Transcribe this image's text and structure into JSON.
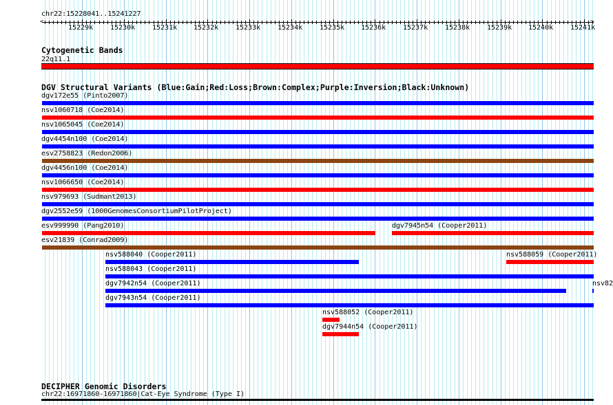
{
  "ruler": {
    "range_label": "chr22:15228041..15241227",
    "tick_labels": [
      "15229k",
      "15230k",
      "15231k",
      "15232k",
      "15233k",
      "15234k",
      "15235k",
      "15236k",
      "15237k",
      "15238k",
      "15239k",
      "15240k",
      "15241k"
    ]
  },
  "cytoband": {
    "title": "Cytogenetic Bands",
    "label": "22q11.1",
    "color": "#ff0000"
  },
  "dgv": {
    "title": "DGV Structural Variants (Blue:Gain;Red:Loss;Brown:Complex;Purple:Inversion;Black:Unknown)",
    "colors": {
      "gain": "#0000ff",
      "loss": "#ff0000",
      "complex": "#8b4513"
    },
    "features": [
      {
        "label": "dgv172e55 (Pinto2007)",
        "type": "gain"
      },
      {
        "label": "nsv1060718 (Coe2014)",
        "type": "loss"
      },
      {
        "label": "nsv1065045 (Coe2014)",
        "type": "gain"
      },
      {
        "label": "dgv4454n100 (Coe2014)",
        "type": "gain"
      },
      {
        "label": "esv2758823 (Redon2006)",
        "type": "complex"
      },
      {
        "label": "dgv4456n100 (Coe2014)",
        "type": "gain"
      },
      {
        "label": "nsv1066650 (Coe2014)",
        "type": "loss"
      },
      {
        "label": "nsv979693 (Sudmant2013)",
        "type": "gain"
      },
      {
        "label": "dgv2552e59 (1000GenomesConsortiumPilotProject)",
        "type": "gain"
      },
      {
        "label": "esv999990 (Pang2010)",
        "type": "loss"
      },
      {
        "label": "dgv7945n54 (Cooper2011)",
        "type": "loss"
      },
      {
        "label": "esv21839 (Conrad2009)",
        "type": "complex"
      },
      {
        "label": "nsv588040 (Cooper2011)",
        "type": "gain"
      },
      {
        "label": "nsv588059 (Cooper2011)",
        "type": "loss"
      },
      {
        "label": "nsv588043 (Cooper2011)",
        "type": "gain"
      },
      {
        "label": "dgv7942n54 (Cooper2011)",
        "type": "gain"
      },
      {
        "label": "nsv82",
        "type": "gain"
      },
      {
        "label": "dgv7943n54 (Cooper2011)",
        "type": "gain"
      },
      {
        "label": "nsv588052 (Cooper2011)",
        "type": "loss"
      },
      {
        "label": "dgv7944n54 (Cooper2011)",
        "type": "loss"
      }
    ]
  },
  "decipher": {
    "title": "DECIPHER Genomic Disorders",
    "label": "chr22:16971860-16971860|Cat-Eye Syndrome (Type I)",
    "color": "#000000"
  }
}
